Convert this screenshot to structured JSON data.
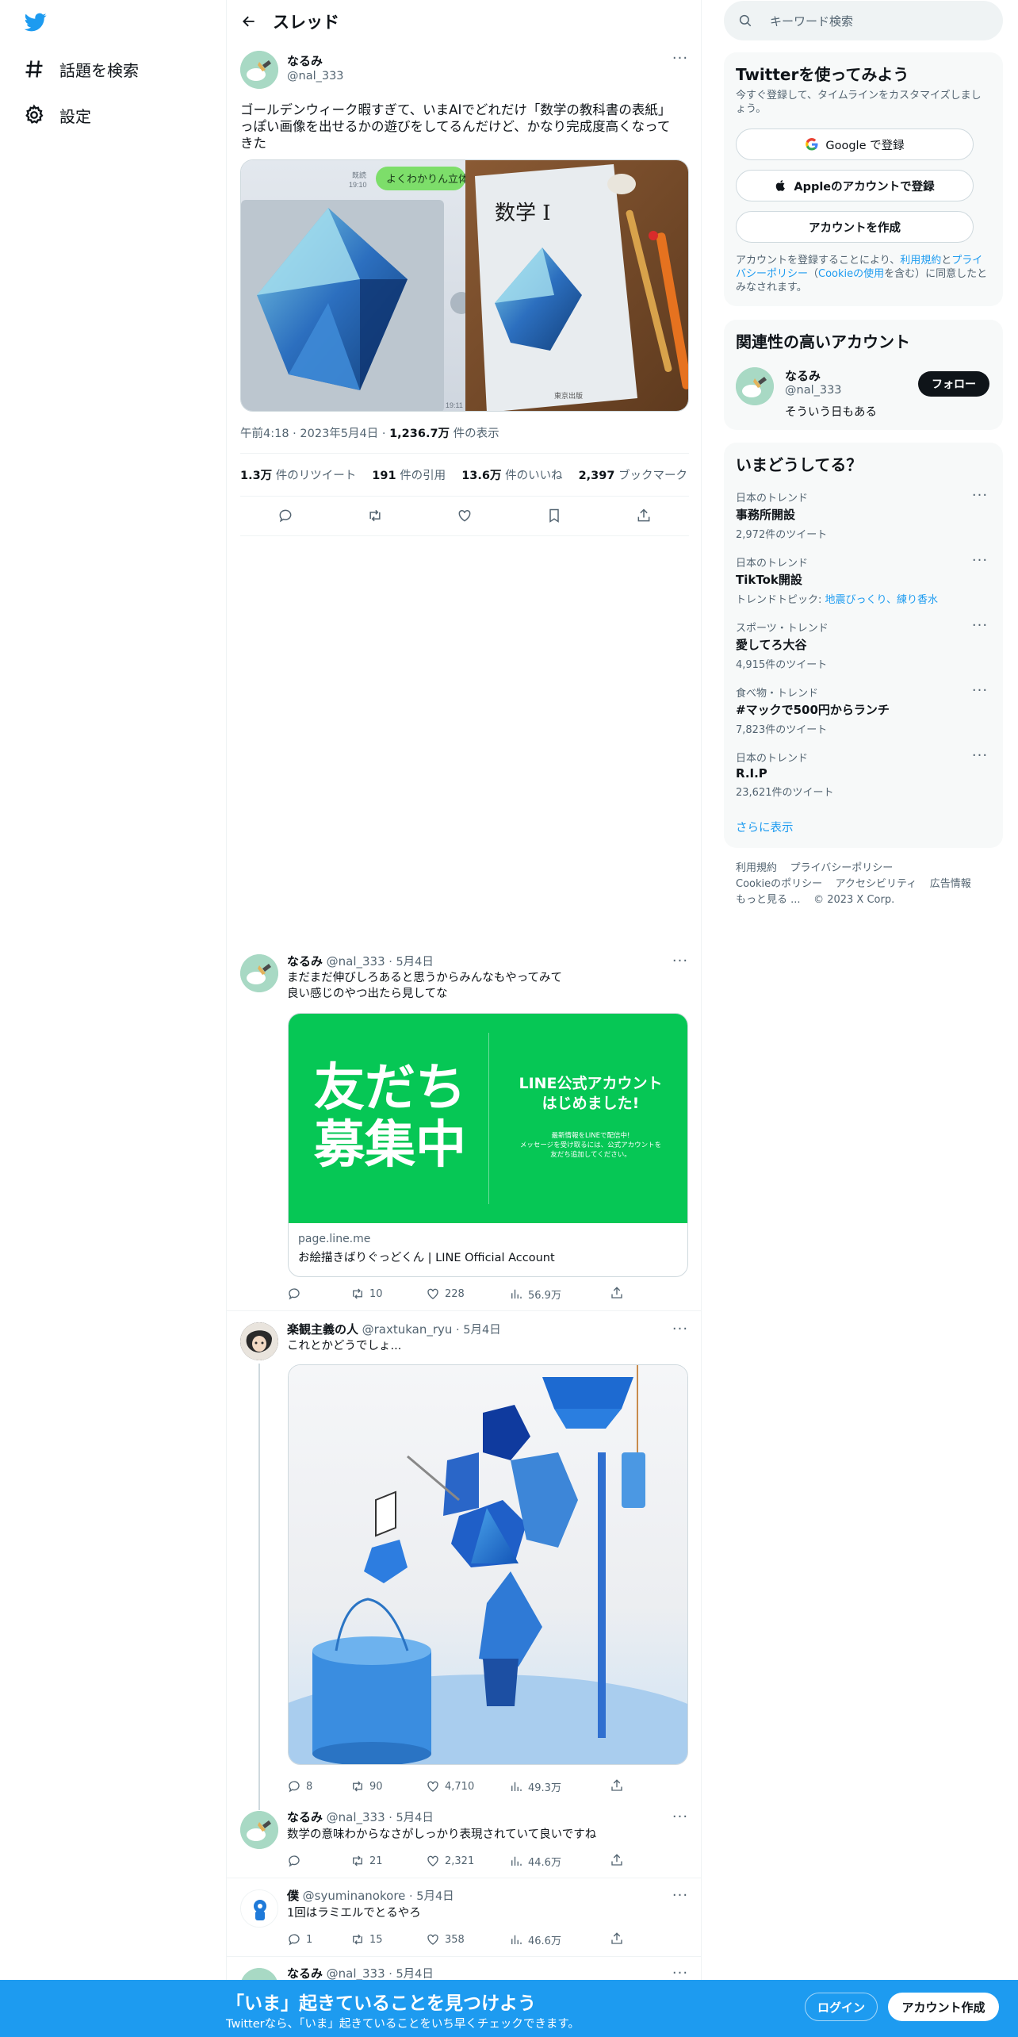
{
  "nav": {
    "explore_label": "話題を検索",
    "settings_label": "設定"
  },
  "thread": {
    "header_title": "スレッド",
    "main": {
      "name": "なるみ",
      "handle": "@nal_333",
      "text_line1": "ゴールデンウィーク暇すぎて、いまAIでどれだけ「数学の教科書の表紙」",
      "text_line2": "っぽい画像を出せるかの遊びをしてるんだけど、かなり完成度高くなって",
      "text_line3": "きた",
      "media_bubble": "よくわかりん立体",
      "media_time_top": "既読",
      "media_time": "19:10",
      "media_time2": "19:11",
      "book_title": "数学 I",
      "book_publisher": "東京出版",
      "time": "午前4:18",
      "date": "2023年5月4日",
      "views": "1,236.7万",
      "views_label": "件の表示",
      "retweets": "1.3万",
      "retweets_label": "件のリツイート",
      "quotes": "191",
      "quotes_label": "件の引用",
      "likes": "13.6万",
      "likes_label": "件のいいね",
      "bookmarks": "2,397",
      "bookmarks_label": "ブックマーク"
    },
    "replies": [
      {
        "name": "なるみ",
        "handle": "@nal_333",
        "date": "5月4日",
        "line1": "まだまだ伸びしろあると思うからみんなもやってみて",
        "line2": "良い感じのやつ出たら見してな",
        "card_big_1": "友だち",
        "card_big_2": "募集中",
        "card_right_1": "LINE公式アカウント",
        "card_right_2": "はじめました!",
        "card_small_1": "最新情報をLINEで配信中!",
        "card_small_2": "メッセージを受け取るには、公式アカウントを",
        "card_small_3": "友だち追加してください。",
        "card_domain": "page.line.me",
        "card_title": "お絵描きばりぐっどくん | LINE Official Account",
        "replies": "",
        "retweets": "10",
        "likes": "228",
        "views": "56.9万"
      },
      {
        "name": "楽観主義の人",
        "handle": "@raxtukan_ryu",
        "date": "5月4日",
        "line1": "これとかどうでしょ...",
        "replies": "8",
        "retweets": "90",
        "likes": "4,710",
        "views": "49.3万"
      },
      {
        "name": "なるみ",
        "handle": "@nal_333",
        "date": "5月4日",
        "line1": "数学の意味わからなさがしっかり表現されていて良いですね",
        "replies": "",
        "retweets": "21",
        "likes": "2,321",
        "views": "44.6万"
      },
      {
        "name": "僕",
        "handle": "@syuminanokore",
        "date": "5月4日",
        "line1": "1回はラミエルでとるやろ",
        "replies": "1",
        "retweets": "15",
        "likes": "358",
        "views": "46.6万"
      },
      {
        "name": "なるみ",
        "handle": "@nal_333",
        "date": "5月4日"
      }
    ]
  },
  "sidebar": {
    "search_placeholder": "キーワード検索",
    "signup": {
      "title": "Twitterを使ってみよう",
      "subtitle": "今すぐ登録して、タイムラインをカスタマイズしましょう。",
      "google_label": "Google で登録",
      "apple_label": "Appleのアカウントで登録",
      "create_label": "アカウントを作成",
      "terms_prefix": "アカウントを登録することにより、",
      "terms_link": "利用規約",
      "terms_and": "と",
      "privacy_link": "プライバシーポリシー",
      "cookie_open": "（",
      "cookie_link": "Cookieの使用",
      "terms_suffix": "を含む）に同意したとみなされます。"
    },
    "relevant": {
      "title": "関連性の高いアカウント",
      "name": "なるみ",
      "handle": "@nal_333",
      "bio": "そういう日もある",
      "follow_label": "フォロー"
    },
    "trends": {
      "title": "いまどうしてる？",
      "items": [
        {
          "category": "日本のトレンド",
          "name": "事務所開設",
          "count": "2,972件のツイート"
        },
        {
          "category": "日本のトレンド",
          "name": "TikTok開設",
          "count_prefix": "トレンドトピック: ",
          "count_link": "地震びっくり、練り香水"
        },
        {
          "category": "スポーツ・トレンド",
          "name": "愛してろ大谷",
          "count": "4,915件のツイート"
        },
        {
          "category": "食べ物・トレンド",
          "name": "#マックで500円からランチ",
          "count": "7,823件のツイート"
        },
        {
          "category": "日本のトレンド",
          "name": "R.I.P",
          "count": "23,621件のツイート"
        }
      ],
      "show_more": "さらに表示"
    },
    "footer": {
      "terms": "利用規約",
      "privacy": "プライバシーポリシー",
      "cookie": "Cookieのポリシー",
      "accessibility": "アクセシビリティ",
      "ads": "広告情報",
      "more": "もっと見る ...",
      "copyright": "© 2023 X Corp."
    }
  },
  "bottom_bar": {
    "title": "「いま」起きていることを見つけよう",
    "subtitle": "Twitterなら、「いま」起きていることをいち早くチェックできます。",
    "login_label": "ログイン",
    "signup_label": "アカウント作成"
  },
  "colors": {
    "accent": "#1d9bf0",
    "line_green": "#06c755",
    "text": "#0f1419",
    "muted": "#536471"
  }
}
